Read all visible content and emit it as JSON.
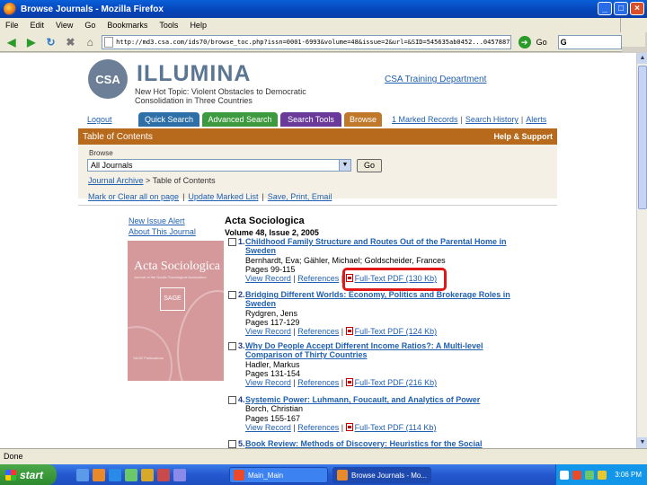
{
  "window": {
    "title": "Browse Journals - Mozilla Firefox",
    "controls": [
      "_",
      "□",
      "×"
    ]
  },
  "menubar": [
    "File",
    "Edit",
    "View",
    "Go",
    "Bookmarks",
    "Tools",
    "Help"
  ],
  "navbar": {
    "url": "http://md3.csa.com/ids70/browse_toc.php?issn=0001-6993&volume=48&issue=2&url=&SID=545635ab0452...04578873",
    "go_label": "Go",
    "search_value": "G"
  },
  "site": {
    "logo_text": "CSA",
    "brand": "ILLUMINA",
    "new_hot_topic": "New Hot Topic: Violent Obstacles to Democratic Consolidation in Three Countries",
    "training_link": "CSA Training Department"
  },
  "tabs": {
    "logout": "Logout",
    "quick_search": "Quick Search",
    "advanced_search": "Advanced Search",
    "search_tools": "Search Tools",
    "browse": "Browse"
  },
  "top_links": {
    "marked": "1 Marked Records",
    "history": "Search History",
    "alerts": "Alerts"
  },
  "toc_bar": {
    "title": "Table of Contents",
    "help": "Help & Support"
  },
  "browse": {
    "label": "Browse",
    "selected": "All Journals",
    "go": "Go",
    "crumb_link": "Journal Archive",
    "crumb_rest": " > Table of Contents"
  },
  "markbar": {
    "mark_or_clear": "Mark or Clear all on page",
    "update": "Update Marked List",
    "save": "Save, Print, Email"
  },
  "sidebar": {
    "new_issue_alert": "New Issue Alert",
    "about": "About This Journal"
  },
  "cover": {
    "title": "Acta Sociologica",
    "subtitle": "Journal of the Nordic Sociological Association",
    "seal": "SAGE",
    "publisher": "SAGE Publications"
  },
  "journal": {
    "title": "Acta Sociologica",
    "volume": "Volume 48, Issue 2, 2005"
  },
  "articles": [
    {
      "num": "1.",
      "title": "Childhood Family Structure and Routes Out of the Parental Home in Sweden",
      "authors": "Bernhardt, Eva; Gähler, Michael; Goldscheider, Frances",
      "pages": "Pages 99-115",
      "view": "View Record",
      "refs": "References",
      "pdf": "Full-Text PDF (130 Kb)"
    },
    {
      "num": "2.",
      "title": "Bridging Different Worlds: Economy, Politics and Brokerage Roles in Sweden",
      "authors": "Rydgren, Jens",
      "pages": "Pages 117-129",
      "view": "View Record",
      "refs": "References",
      "pdf": "Full-Text PDF (124 Kb)"
    },
    {
      "num": "3.",
      "title": "Why Do People Accept Different Income Ratios?: A Multi-level Comparison of Thirty Countries",
      "authors": "Hadler, Markus",
      "pages": "Pages 131-154",
      "view": "View Record",
      "refs": "References",
      "pdf": "Full-Text PDF (216 Kb)"
    },
    {
      "num": "4.",
      "title": "Systemic Power: Luhmann, Foucault, and Analytics of Power",
      "authors": "Borch, Christian",
      "pages": "Pages 155-167",
      "view": "View Record",
      "refs": "References",
      "pdf": "Full-Text PDF (114 Kb)"
    },
    {
      "num": "5.",
      "title": "Book Review: Methods of Discovery: Heuristics for the Social"
    }
  ],
  "status": "Done",
  "taskbar": {
    "start": "start",
    "items": [
      "Main_Main",
      "Browse Journals - Mo..."
    ],
    "clock": "3:06 PM"
  }
}
